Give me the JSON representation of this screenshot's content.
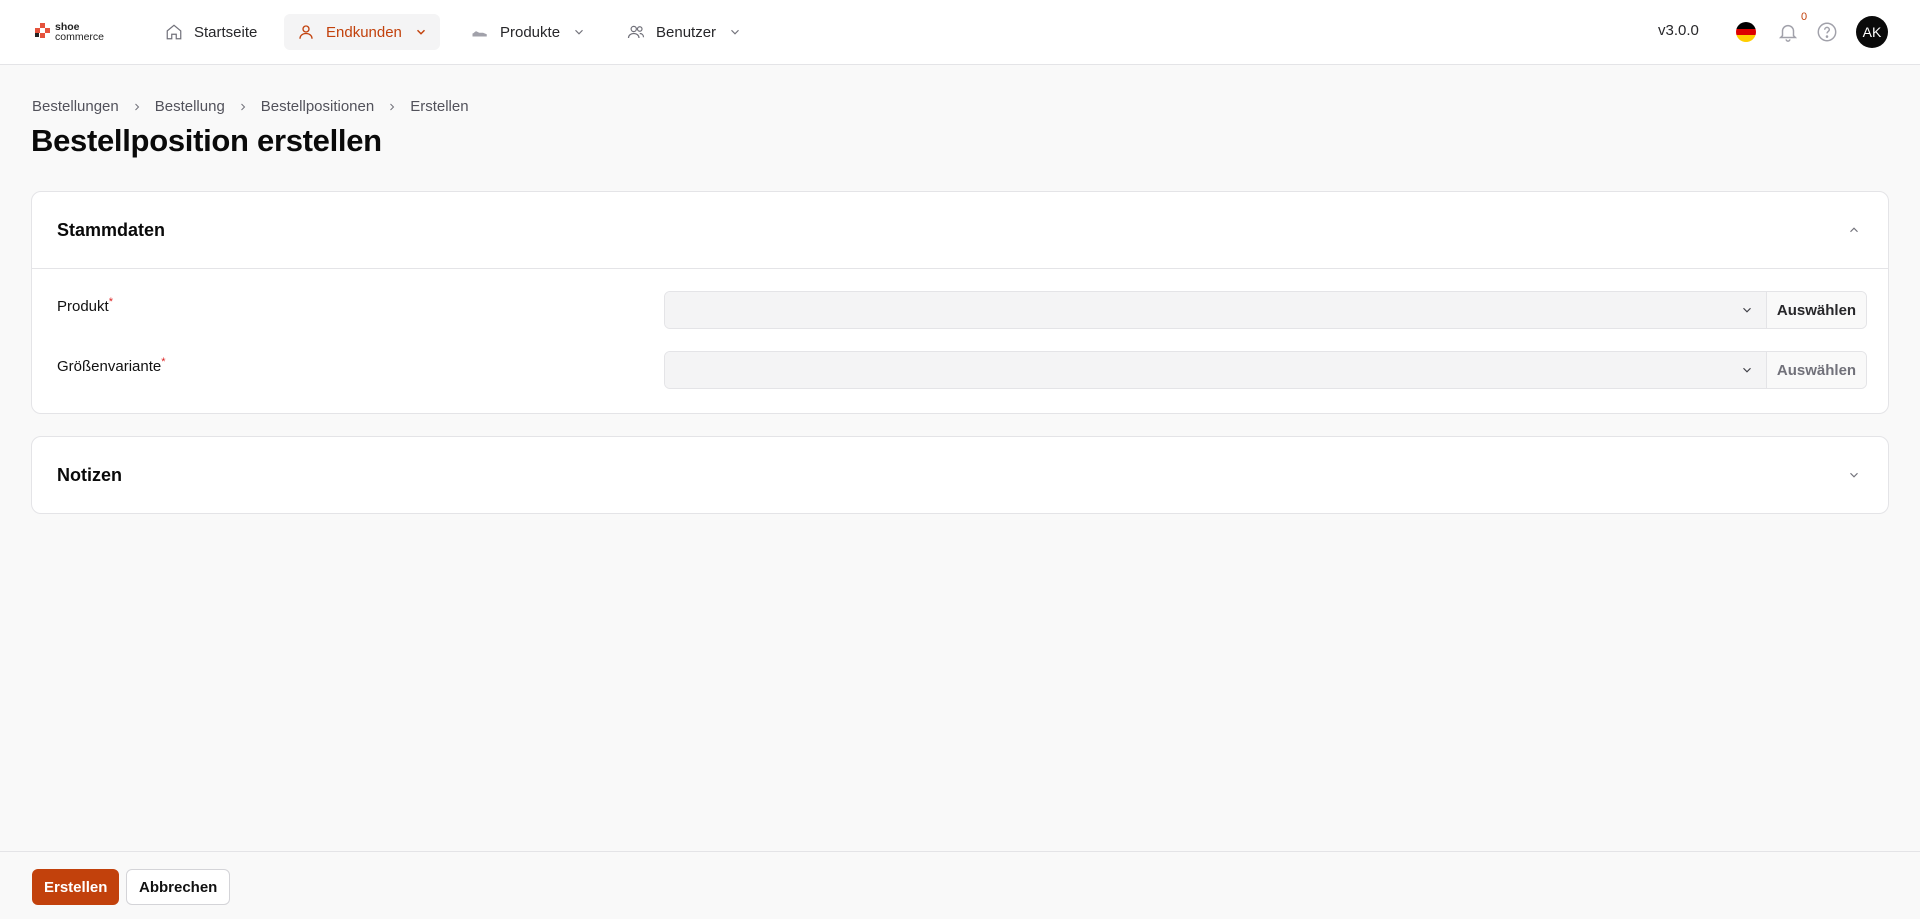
{
  "brand": {
    "logo_line1": "shoe",
    "logo_line2": "commerce",
    "accent": "#c2410c"
  },
  "nav": {
    "items": [
      {
        "label": "Startseite",
        "icon": "home-icon",
        "dropdown": false,
        "active": false
      },
      {
        "label": "Endkunden",
        "icon": "user-icon",
        "dropdown": true,
        "active": true
      },
      {
        "label": "Produkte",
        "icon": "shoe-icon",
        "dropdown": true,
        "active": false
      },
      {
        "label": "Benutzer",
        "icon": "users-icon",
        "dropdown": true,
        "active": false
      }
    ]
  },
  "header": {
    "version": "v3.0.0",
    "language_flag": "de-flag-icon",
    "notifications_count": "0",
    "avatar_initials": "AK"
  },
  "breadcrumb": [
    "Bestellungen",
    "Bestellung",
    "Bestellpositionen",
    "Erstellen"
  ],
  "page": {
    "title": "Bestellposition erstellen"
  },
  "sections": {
    "stammdaten": {
      "title": "Stammdaten",
      "expanded": true,
      "fields": [
        {
          "label": "Produkt",
          "required": "*",
          "value": "",
          "button": "Auswählen",
          "button_enabled": true
        },
        {
          "label": "Größenvariante",
          "required": "*",
          "value": "",
          "button": "Auswählen",
          "button_enabled": false
        }
      ]
    },
    "notizen": {
      "title": "Notizen",
      "expanded": false
    }
  },
  "footer": {
    "create_label": "Erstellen",
    "cancel_label": "Abbrechen"
  }
}
